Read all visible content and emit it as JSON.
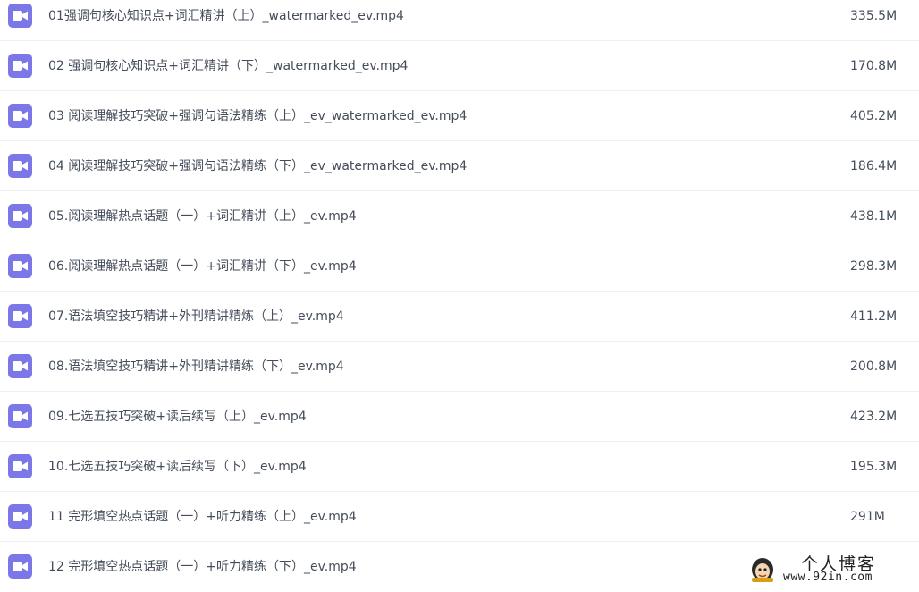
{
  "files": [
    {
      "name": "01强调句核心知识点+词汇精讲（上）_watermarked_ev.mp4",
      "size": "335.5M"
    },
    {
      "name": "02 强调句核心知识点+词汇精讲（下）_watermarked_ev.mp4",
      "size": "170.8M"
    },
    {
      "name": "03 阅读理解技巧突破+强调句语法精练（上）_ev_watermarked_ev.mp4",
      "size": "405.2M"
    },
    {
      "name": "04 阅读理解技巧突破+强调句语法精练（下）_ev_watermarked_ev.mp4",
      "size": "186.4M"
    },
    {
      "name": "05.阅读理解热点话题（一）+词汇精讲（上）_ev.mp4",
      "size": "438.1M"
    },
    {
      "name": "06.阅读理解热点话题（一）+词汇精讲（下）_ev.mp4",
      "size": "298.3M"
    },
    {
      "name": "07.语法填空技巧精讲+外刊精讲精炼（上）_ev.mp4",
      "size": "411.2M"
    },
    {
      "name": "08.语法填空技巧精讲+外刊精讲精练（下）_ev.mp4",
      "size": "200.8M"
    },
    {
      "name": "09.七选五技巧突破+读后续写（上）_ev.mp4",
      "size": "423.2M"
    },
    {
      "name": "10.七选五技巧突破+读后续写（下）_ev.mp4",
      "size": "195.3M"
    },
    {
      "name": "11 完形填空热点话题（一）+听力精练（上）_ev.mp4",
      "size": "291M"
    },
    {
      "name": "12 完形填空热点话题（一）+听力精练（下）_ev.mp4",
      "size": ""
    }
  ],
  "icon": {
    "name": "video-file-icon",
    "color": "#7b77e8"
  },
  "watermark": {
    "title": "个人博客",
    "url": "www.92in.com"
  }
}
